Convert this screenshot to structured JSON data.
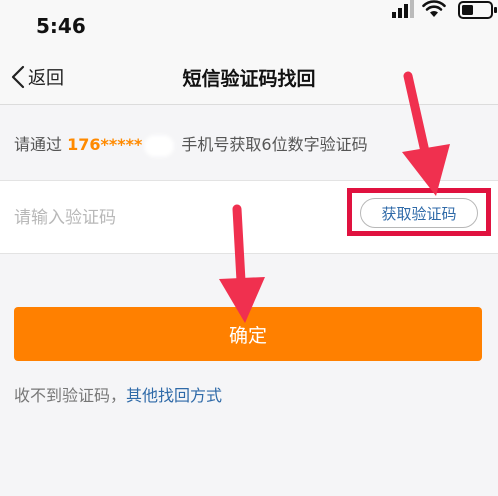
{
  "status_bar": {
    "time": "5:46",
    "icons": [
      "signal-icon",
      "wifi-icon",
      "battery-icon"
    ]
  },
  "nav": {
    "back_label": "返回",
    "title": "短信验证码找回"
  },
  "hint": {
    "prefix": "请通过 ",
    "phone": "176*****",
    "suffix": " 手机号获取6位数字验证码"
  },
  "code_field": {
    "placeholder": "请输入验证码",
    "value": ""
  },
  "get_code_button": {
    "label": "获取验证码"
  },
  "confirm_button": {
    "label": "确定"
  },
  "footer": {
    "text": "收不到验证码，",
    "link": "其他找回方式"
  },
  "colors": {
    "accent": "#ff8000",
    "phone_highlight": "#ff8a00",
    "link": "#2f6aa8",
    "annotation": "#e0123f",
    "arrow": "#f0304f"
  }
}
